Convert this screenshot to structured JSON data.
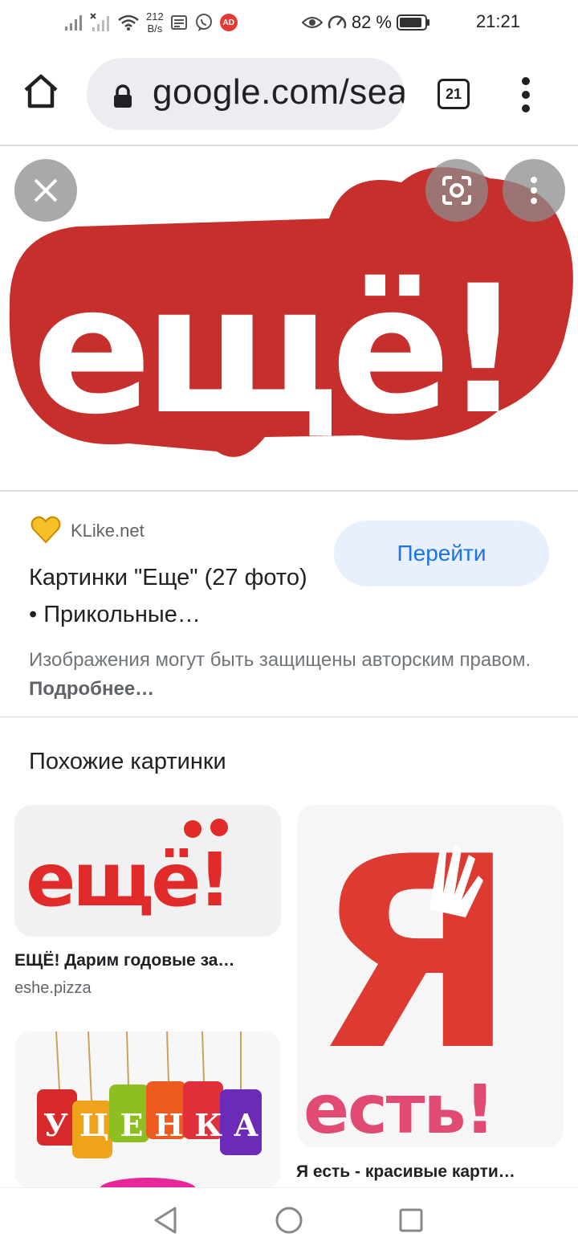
{
  "status_bar": {
    "net_speed_value": "212",
    "net_speed_unit": "B/s",
    "ad_badge": "AD",
    "battery_percent": "82 %",
    "time": "21:21"
  },
  "toolbar": {
    "url": "google.com/search",
    "tab_count": "21",
    "icons": [
      "home-icon",
      "lock-icon",
      "tabs-icon",
      "more-vert-icon"
    ]
  },
  "viewer": {
    "hero_text": "ещё!",
    "hero_color": "#c62f2b",
    "icons": [
      "close-icon",
      "lens-icon",
      "more-vert-icon"
    ]
  },
  "result": {
    "source_name": "KLike.net",
    "goto_label": "Перейти",
    "title": "Картинки \"Еще\" (27 фото) • Прикольные…",
    "copyright_text": "Изображения могут быть защищены авторским правом.",
    "learn_more": "Подробнее…"
  },
  "related": {
    "heading": "Похожие картинки",
    "items": [
      {
        "caption": "ЕЩЁ! Дарим годовые за…",
        "source": "eshe.pizza",
        "image_text": "ещё!"
      },
      {
        "caption": "Я есть - красивые карти…",
        "source": "",
        "image_text_big": "Я",
        "image_text_small": "есть!"
      },
      {
        "caption": "",
        "source": "",
        "image_text": "УЦЕНКА"
      }
    ]
  },
  "navigation": {
    "icons": [
      "back-icon",
      "home-circle-icon",
      "recents-icon"
    ]
  }
}
